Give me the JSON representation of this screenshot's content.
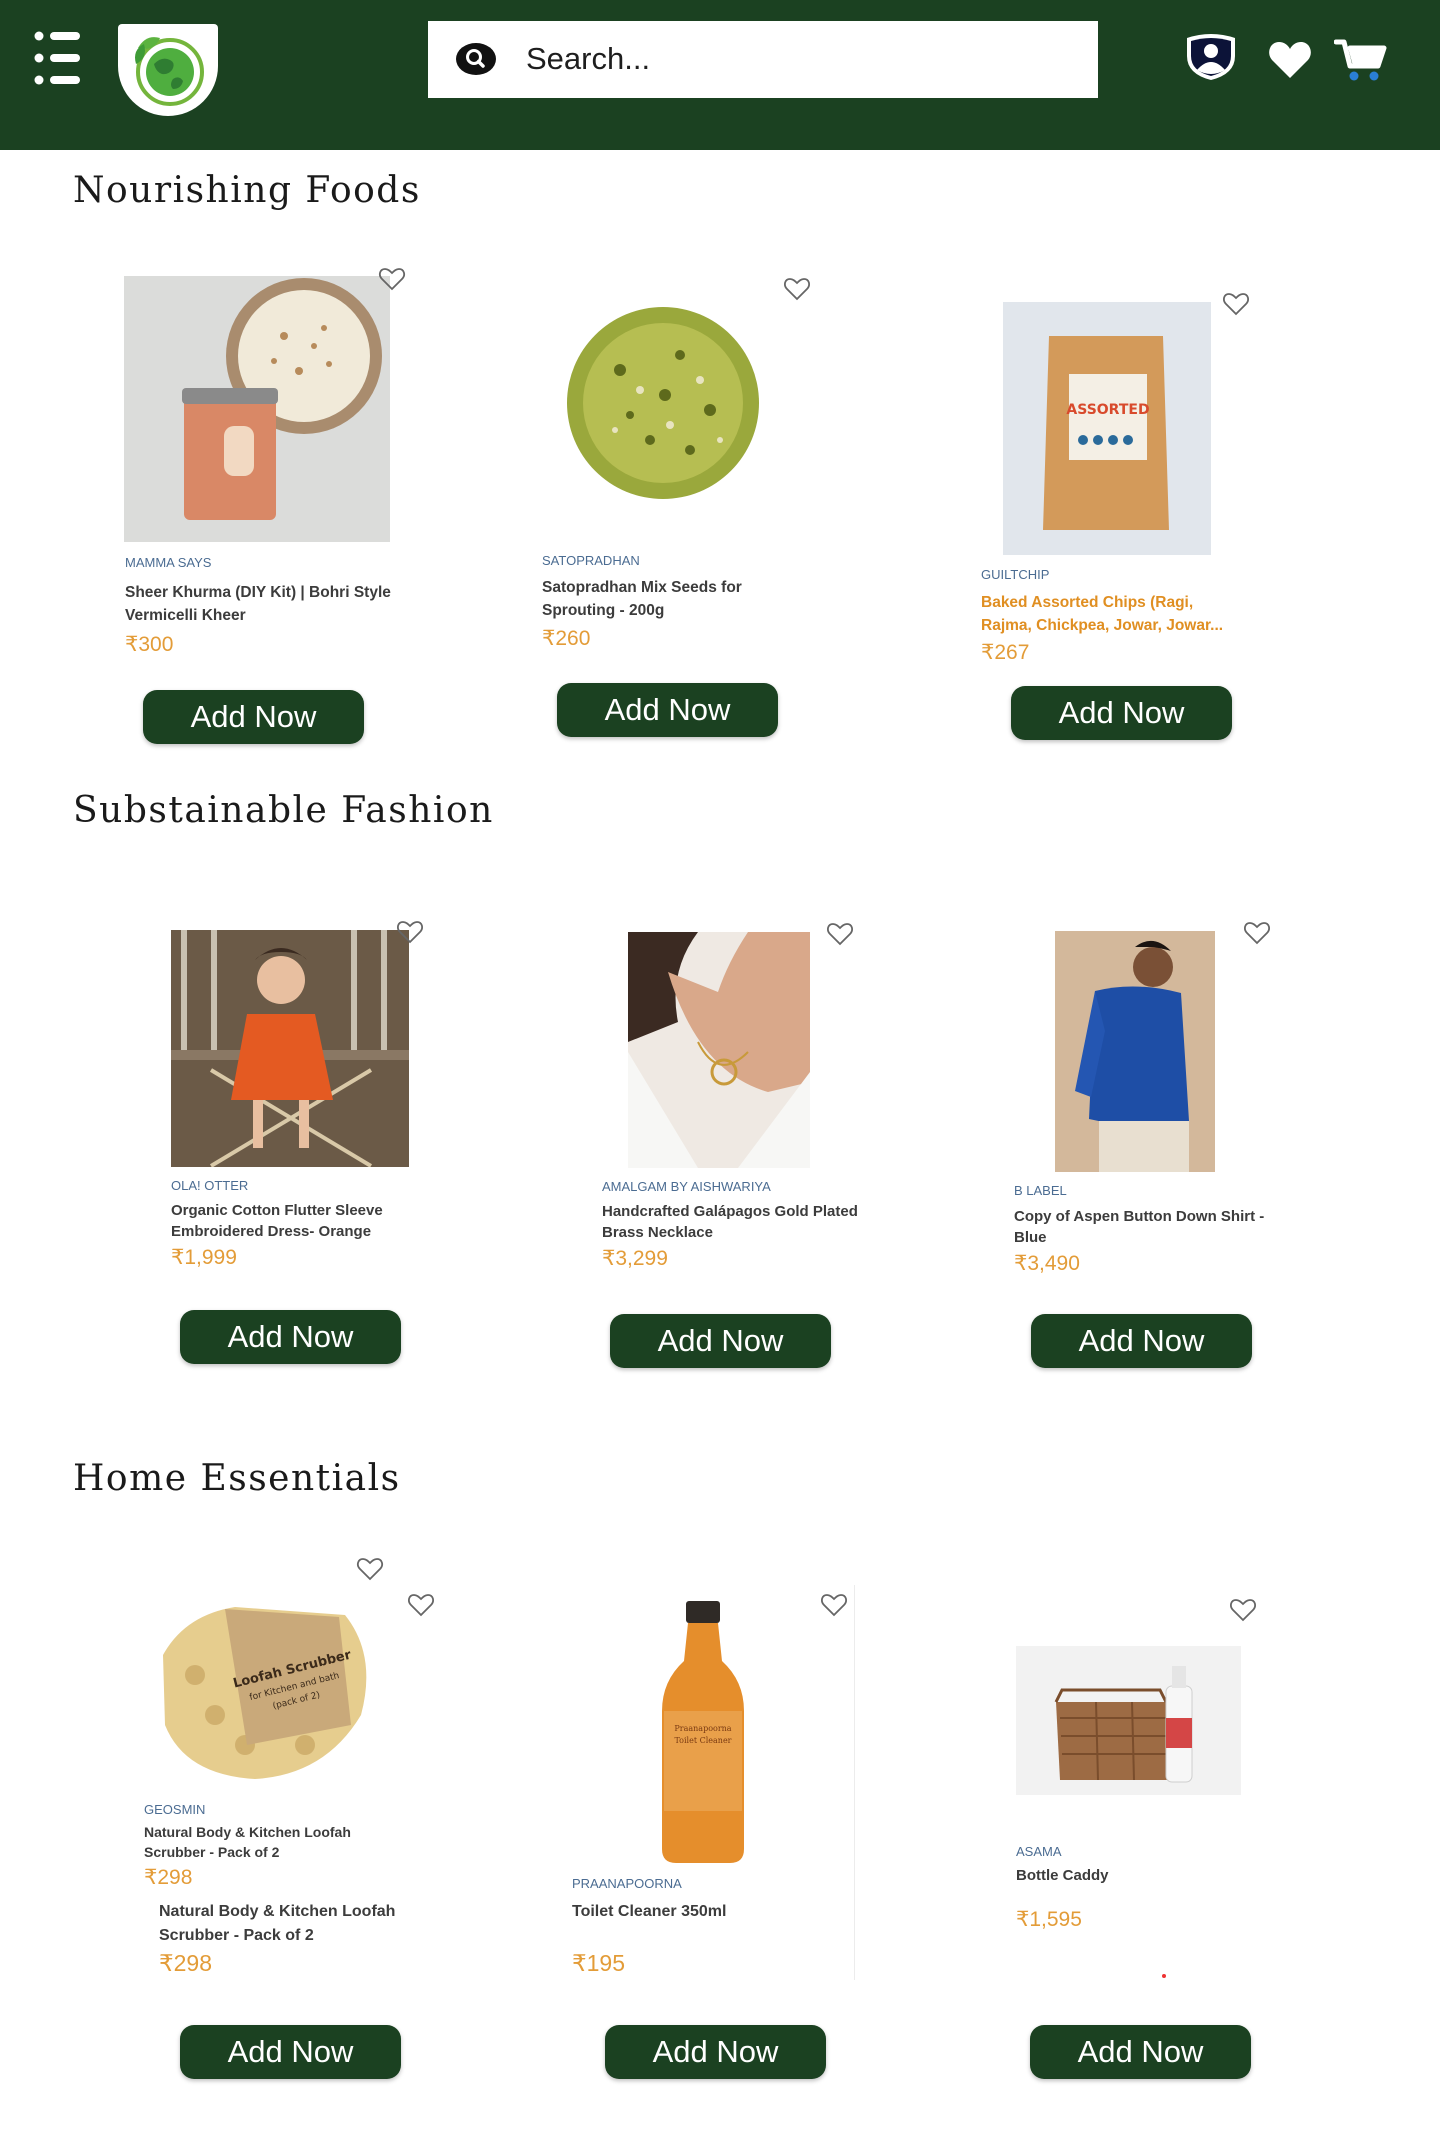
{
  "header": {
    "search_placeholder": "Search..."
  },
  "sections": [
    {
      "title": "Nourishing Foods",
      "products": [
        {
          "brand": "MAMMA SAYS",
          "name": "Sheer Khurma (DIY Kit) | Bohri Style Vermicelli Kheer",
          "price": "₹300",
          "button": "Add Now"
        },
        {
          "brand": "SATOPRADHAN",
          "name": "Satopradhan Mix Seeds for Sprouting - 200g",
          "price": "₹260",
          "button": "Add Now"
        },
        {
          "brand": "GUILTCHIP",
          "name": "Baked Assorted Chips (Ragi, Rajma, Chickpea, Jowar, Jowar...",
          "price": "₹267",
          "button": "Add Now"
        }
      ]
    },
    {
      "title": "Substainable Fashion",
      "products": [
        {
          "brand": "OLA! OTTER",
          "name": "Organic Cotton Flutter Sleeve Embroidered Dress- Orange",
          "price": "₹1,999",
          "button": "Add Now"
        },
        {
          "brand": "AMALGAM BY AISHWARIYA",
          "name": "Handcrafted Galápagos Gold Plated Brass Necklace",
          "price": "₹3,299",
          "button": "Add Now"
        },
        {
          "brand": "B LABEL",
          "name": "Copy of Aspen Button Down Shirt - Blue",
          "price": "₹3,490",
          "button": "Add Now"
        }
      ]
    },
    {
      "title": "Home Essentials",
      "products": [
        {
          "brand": "GEOSMIN",
          "name": "Natural Body & Kitchen Loofah Scrubber - Pack of 2",
          "price": "₹298",
          "name2": "Natural Body & Kitchen Loofah Scrubber - Pack of 2",
          "price2": "₹298",
          "button": "Add Now",
          "image_text": [
            "Loofah Scrubber",
            "for Kitchen and bath",
            "(pack of 2)"
          ]
        },
        {
          "brand": "PRAANAPOORNA",
          "name": "Toilet Cleaner 350ml",
          "price": "₹195",
          "button": "Add Now",
          "image_text": [
            "Praanapoorna",
            "Toilet Cleaner"
          ]
        },
        {
          "brand": "ASAMA",
          "name": "Bottle Caddy",
          "price": "₹1,595",
          "button": "Add Now"
        }
      ]
    }
  ],
  "product_images": {
    "chips_pack_text": "ASSORTED"
  },
  "colors": {
    "header_bg": "#1b4121",
    "button_bg": "#1b4121",
    "price": "#e39c38",
    "brand": "#4b6c92",
    "highlight_name": "#e08f22"
  },
  "icons": [
    "menu-icon",
    "logo-icon",
    "search-icon",
    "account-icon",
    "heart-icon",
    "cart-icon",
    "wishlist-heart-icon"
  ]
}
